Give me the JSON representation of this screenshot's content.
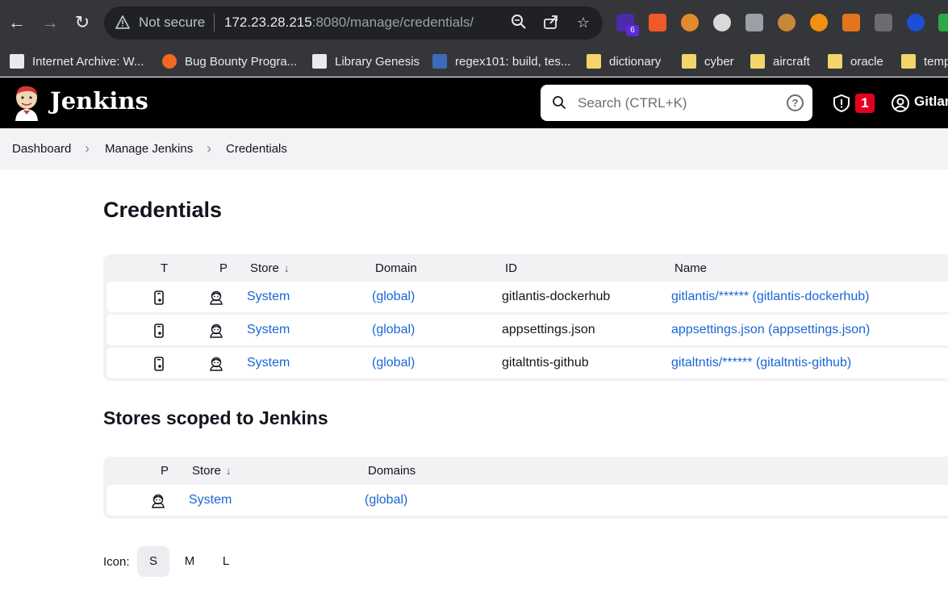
{
  "browser": {
    "not_secure_label": "Not secure",
    "url_host": "172.23.28.215",
    "url_rest": ":8080/manage/credentials/",
    "extension_badge": "6",
    "bookmarks": [
      {
        "label": "Internet Archive: W...",
        "icon": "archive-icon"
      },
      {
        "label": "Bug Bounty Progra...",
        "icon": "bugcrowd-icon"
      },
      {
        "label": "Library Genesis",
        "icon": "library-icon"
      },
      {
        "label": "regex101: build, tes...",
        "icon": "regex-icon"
      },
      {
        "label": "dictionary",
        "icon": "folder-icon"
      },
      {
        "label": "cyber",
        "icon": "folder-icon"
      },
      {
        "label": "aircraft",
        "icon": "folder-icon"
      },
      {
        "label": "oracle",
        "icon": "folder-icon"
      },
      {
        "label": "temp",
        "icon": "folder-icon"
      }
    ]
  },
  "header": {
    "title": "Jenkins",
    "search_placeholder": "Search (CTRL+K)",
    "help_glyph": "?",
    "security_count": "1",
    "user_name": "Gitlantis"
  },
  "breadcrumbs": [
    "Dashboard",
    "Manage Jenkins",
    "Credentials"
  ],
  "credentials": {
    "title": "Credentials",
    "columns": {
      "t": "T",
      "p": "P",
      "store": "Store",
      "domain": "Domain",
      "id": "ID",
      "name": "Name"
    },
    "sort_indicator": "↓",
    "rows": [
      {
        "store": "System",
        "domain": "(global)",
        "id": "gitlantis-dockerhub",
        "name": "gitlantis/****** (gitlantis-dockerhub)"
      },
      {
        "store": "System",
        "domain": "(global)",
        "id": "appsettings.json",
        "name": "appsettings.json (appsettings.json)"
      },
      {
        "store": "System",
        "domain": "(global)",
        "id": "gitaltntis-github",
        "name": "gitaltntis/****** (gitaltntis-github)"
      }
    ]
  },
  "stores": {
    "title": "Stores scoped to Jenkins",
    "columns": {
      "p": "P",
      "store": "Store",
      "domains": "Domains"
    },
    "rows": [
      {
        "store": "System",
        "domains": "(global)"
      }
    ]
  },
  "icon_size": {
    "label": "Icon:",
    "options": [
      "S",
      "M",
      "L"
    ],
    "selected": "S"
  }
}
